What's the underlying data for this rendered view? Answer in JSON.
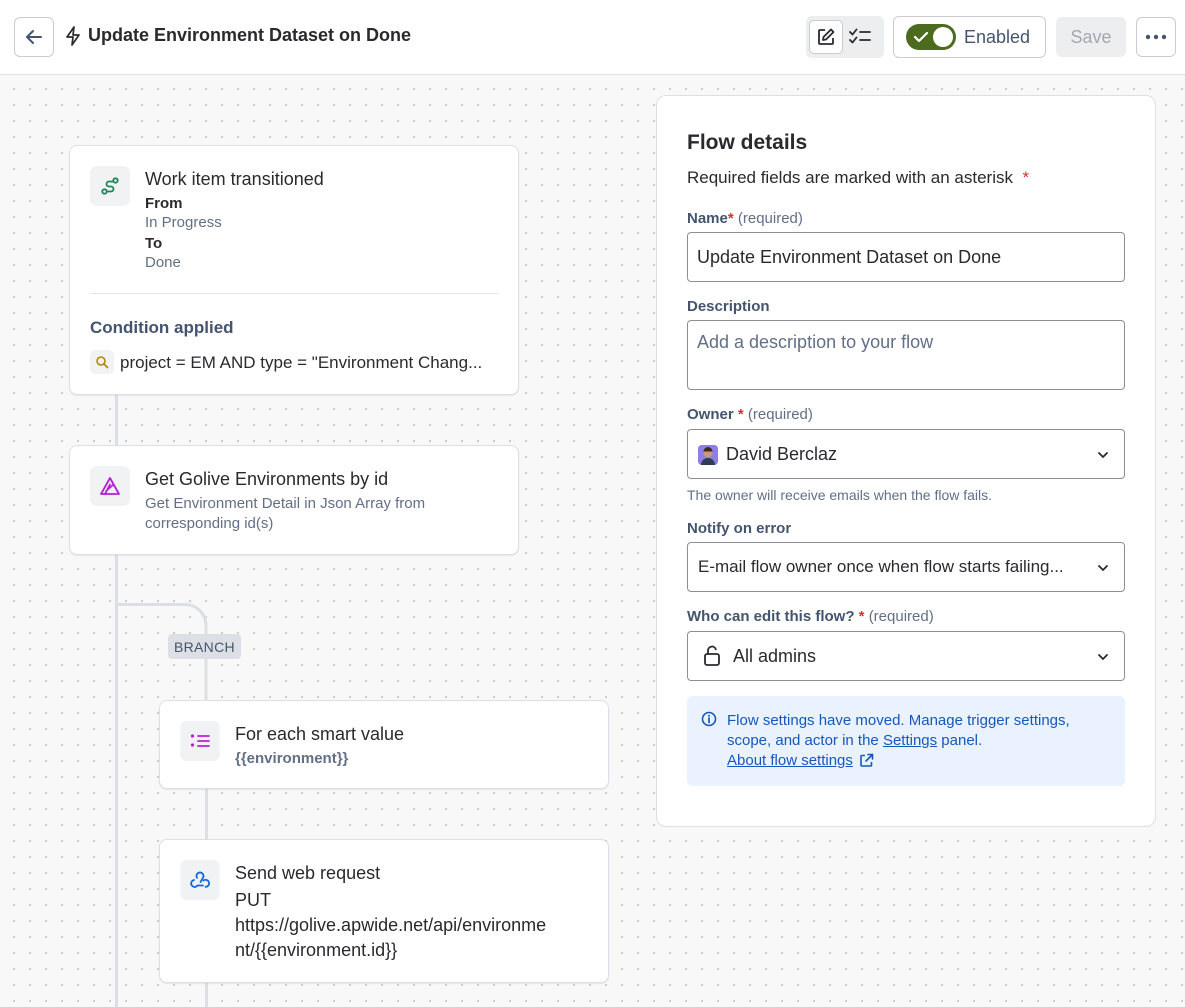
{
  "header": {
    "title": "Update Environment Dataset on Done",
    "enabled_label": "Enabled",
    "save_label": "Save"
  },
  "trigger": {
    "title": "Work item transitioned",
    "from_label": "From",
    "from_value": "In Progress",
    "to_label": "To",
    "to_value": "Done",
    "condition_title": "Condition applied",
    "condition_query": "project = EM AND type = \"Environment Chang..."
  },
  "action_get": {
    "title": "Get Golive Environments by id",
    "description_line1": "Get Environment Detail in Json Array from",
    "description_line2": "corresponding id(s)"
  },
  "branch": {
    "label": "BRANCH",
    "foreach_title": "For each smart value",
    "foreach_value": "{{environment}}"
  },
  "web_request": {
    "title": "Send web request",
    "method": "PUT",
    "url_line1": "https://golive.apwide.net/api/environme",
    "url_line2": "nt/{{environment.id}}"
  },
  "details": {
    "title": "Flow details",
    "required_note": "Required fields are marked with an asterisk",
    "asterisk": "*",
    "name_label": "Name",
    "required_text": "(required)",
    "name_value": "Update Environment Dataset on Done",
    "description_label": "Description",
    "description_placeholder": "Add a description to your flow",
    "owner_label": "Owner",
    "owner_value": "David Berclaz",
    "owner_helper": "The owner will receive emails when the flow fails.",
    "notify_label": "Notify on error",
    "notify_value": "E-mail flow owner once when flow starts failing...",
    "edit_label": "Who can edit this flow?",
    "edit_value": "All admins",
    "info_line1": "Flow settings have moved. Manage trigger settings,",
    "info_line2_prefix": "scope, and actor in the ",
    "info_line2_link": "Settings",
    "info_line2_suffix": " panel.",
    "info_link": "About flow settings"
  },
  "colors": {
    "toggle_on": "#4C6B1F",
    "info_text": "#1558BC",
    "info_bg": "#E9F2FE",
    "asterisk": "#C9372C"
  },
  "icons": [
    "back-arrow-icon",
    "lightning-icon",
    "edit-icon",
    "checklist-icon",
    "check-icon",
    "more-icon",
    "route-icon",
    "search-icon",
    "golive-icon",
    "list-icon",
    "webhook-icon",
    "chevron-down-icon",
    "unlock-icon",
    "info-icon",
    "external-link-icon"
  ]
}
